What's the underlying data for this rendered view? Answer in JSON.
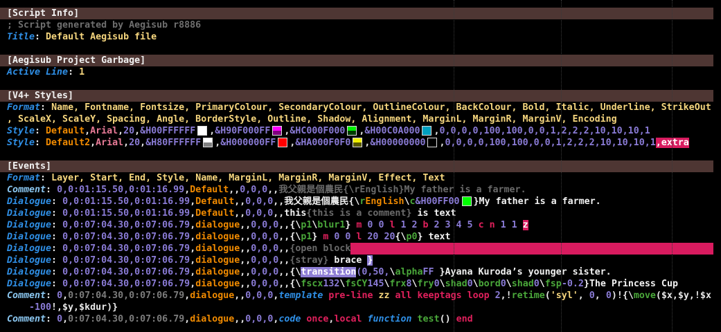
{
  "lines": [
    {
      "hdr": true,
      "segs": [
        [
          "t",
          "[Script Info]"
        ]
      ]
    },
    {
      "segs": [
        [
          "cm",
          "; Script generated by Aegisub r8886"
        ]
      ]
    },
    {
      "segs": [
        [
          "k",
          "Title"
        ],
        [
          "p",
          ": "
        ],
        [
          "v",
          "Default Aegisub file"
        ]
      ]
    },
    {
      "segs": []
    },
    {
      "hdr": true,
      "segs": [
        [
          "t",
          "[Aegisub Project Garbage]"
        ]
      ]
    },
    {
      "segs": [
        [
          "k",
          "Active Line"
        ],
        [
          "p",
          ": "
        ],
        [
          "v",
          "1"
        ]
      ]
    },
    {
      "segs": []
    },
    {
      "hdr": true,
      "segs": [
        [
          "t",
          "[V4+ Styles]"
        ]
      ]
    },
    {
      "segs": [
        [
          "k",
          "Format"
        ],
        [
          "p",
          ": "
        ],
        [
          "v",
          "Name, Fontname, Fontsize, PrimaryColour, SecondaryColour, OutlineColour, BackColour, Bold, Italic, Underline, StrikeOut"
        ]
      ]
    },
    {
      "segs": [
        [
          "v",
          ", ScaleX, ScaleY, Spacing, Angle, BorderStyle, Outline, Shadow, Alignment, MarginL, MarginR, MarginV, Encoding"
        ]
      ]
    },
    {
      "segs": [
        [
          "k",
          "Style"
        ],
        [
          "p",
          ": "
        ],
        [
          "s",
          "Default"
        ],
        [
          "p",
          ","
        ],
        [
          "f",
          "Arial"
        ],
        [
          "p",
          ","
        ],
        [
          "n",
          "20"
        ],
        [
          "p",
          ","
        ],
        [
          "n",
          "&H00FFFFFF"
        ],
        [
          "sw",
          "#ffffff",
          "#ffffff"
        ],
        [
          "p",
          ","
        ],
        [
          "n",
          "&H90F000FF"
        ],
        [
          "sw",
          "#ff00ff",
          "#800080"
        ],
        [
          "p",
          ","
        ],
        [
          "n",
          "&HC000F000"
        ],
        [
          "sw",
          "#00f000",
          "#003c00"
        ],
        [
          "p",
          ","
        ],
        [
          "n",
          "&H00C0A000"
        ],
        [
          "sw",
          "#00a0c0",
          "#00a0c0"
        ],
        [
          "p",
          ","
        ],
        [
          "n",
          "0,0,0,0,100,100,0,0,1,2,2,2,10,10,10,1"
        ]
      ]
    },
    {
      "segs": [
        [
          "k",
          "Style"
        ],
        [
          "p",
          ": "
        ],
        [
          "s",
          "Default2"
        ],
        [
          "p",
          ","
        ],
        [
          "f",
          "Arial"
        ],
        [
          "p",
          ","
        ],
        [
          "n",
          "20"
        ],
        [
          "p",
          ","
        ],
        [
          "n",
          "&H80FFFFFF"
        ],
        [
          "sw",
          "#ffffff",
          "#808080"
        ],
        [
          "p",
          ","
        ],
        [
          "n",
          "&H000000FF"
        ],
        [
          "sw",
          "#ff0000",
          "#ff0000"
        ],
        [
          "p",
          ","
        ],
        [
          "n",
          "&HA000F0F0"
        ],
        [
          "sw",
          "#f0f000",
          "#5a5a00"
        ],
        [
          "p",
          ","
        ],
        [
          "n",
          "&H00000000"
        ],
        [
          "sw",
          "#000000",
          "#000000"
        ],
        [
          "p",
          ","
        ],
        [
          "n",
          "0,0,0,0,100,100,0,0,1,2,2,2,10,10,10,1"
        ],
        [
          "err",
          ",extra"
        ]
      ]
    },
    {
      "segs": []
    },
    {
      "hdr": true,
      "segs": [
        [
          "t",
          "[Events]"
        ]
      ]
    },
    {
      "segs": [
        [
          "k",
          "Format"
        ],
        [
          "p",
          ": "
        ],
        [
          "v",
          "Layer, Start, End, Style, Name, MarginL, MarginR, MarginV, Effect, Text"
        ]
      ]
    },
    {
      "segs": [
        [
          "kc",
          "Comment"
        ],
        [
          "p",
          ": "
        ],
        [
          "n",
          "0,0:01:15.50,0:01:16.99"
        ],
        [
          "p",
          ","
        ],
        [
          "s",
          "Default"
        ],
        [
          "p",
          ",,"
        ],
        [
          "n",
          "0,0,0"
        ],
        [
          "p",
          ",,"
        ],
        [
          "x",
          "我父親是個農民{\\rEnglish}My father is a farmer."
        ]
      ]
    },
    {
      "segs": [
        [
          "k",
          "Dialogue"
        ],
        [
          "p",
          ": "
        ],
        [
          "n",
          "0,0:01:15.50,0:01:16.99"
        ],
        [
          "p",
          ","
        ],
        [
          "s",
          "Default"
        ],
        [
          "p",
          ",,"
        ],
        [
          "n",
          "0,0,0"
        ],
        [
          "p",
          ",,"
        ],
        [
          "t",
          "我父親是個農民{\\"
        ],
        [
          "tg",
          "r"
        ],
        [
          "s",
          "English"
        ],
        [
          "t",
          "\\"
        ],
        [
          "tg",
          "c"
        ],
        [
          "n",
          "&H00FF00"
        ],
        [
          "sw",
          "#00ff00",
          "#00ff00"
        ],
        [
          "t",
          "}My father is a farmer."
        ]
      ]
    },
    {
      "segs": [
        [
          "k",
          "Dialogue"
        ],
        [
          "p",
          ": "
        ],
        [
          "n",
          "0,0:01:15.50,0:01:16.99"
        ],
        [
          "p",
          ","
        ],
        [
          "s",
          "Default"
        ],
        [
          "p",
          ",,"
        ],
        [
          "n",
          "0,0,0"
        ],
        [
          "p",
          ",,"
        ],
        [
          "t",
          "this"
        ],
        [
          "x",
          "{this is a comment}"
        ],
        [
          "t",
          " is text"
        ]
      ]
    },
    {
      "segs": [
        [
          "k",
          "Dialogue"
        ],
        [
          "p",
          ": "
        ],
        [
          "n",
          "0,0:07:04.30,0:07:06.79"
        ],
        [
          "p",
          ","
        ],
        [
          "s",
          "dialogue"
        ],
        [
          "p",
          ",,"
        ],
        [
          "n",
          "0,0,0"
        ],
        [
          "p",
          ",,"
        ],
        [
          "t",
          "{\\"
        ],
        [
          "tg",
          "p1"
        ],
        [
          "t",
          "\\"
        ],
        [
          "tg",
          "blur1"
        ],
        [
          "t",
          "} "
        ],
        [
          "d",
          "m"
        ],
        [
          "n",
          " 0 0 "
        ],
        [
          "d",
          "l"
        ],
        [
          "n",
          " 1 2 "
        ],
        [
          "d",
          "b"
        ],
        [
          "n",
          " 2 3 4 5 "
        ],
        [
          "d",
          "c n"
        ],
        [
          "n",
          " 1 1 "
        ],
        [
          "err",
          "z"
        ]
      ]
    },
    {
      "segs": [
        [
          "k",
          "Dialogue"
        ],
        [
          "p",
          ": "
        ],
        [
          "n",
          "0,0:07:04.30,0:07:06.79"
        ],
        [
          "p",
          ","
        ],
        [
          "s",
          "dialogue"
        ],
        [
          "p",
          ",,"
        ],
        [
          "n",
          "0,0,0"
        ],
        [
          "p",
          ",,"
        ],
        [
          "t",
          "{\\"
        ],
        [
          "tg",
          "p1"
        ],
        [
          "t",
          "} "
        ],
        [
          "d",
          "m"
        ],
        [
          "n",
          " 0 0 "
        ],
        [
          "d",
          "l"
        ],
        [
          "n",
          " 20 20"
        ],
        [
          "t",
          "{\\"
        ],
        [
          "tg",
          "p0"
        ],
        [
          "t",
          "} text"
        ]
      ]
    },
    {
      "segs": [
        [
          "k",
          "Dialogue"
        ],
        [
          "p",
          ": "
        ],
        [
          "n",
          "0,0:07:04.30,0:07:06.79"
        ],
        [
          "p",
          ","
        ],
        [
          "s",
          "dialogue"
        ],
        [
          "p",
          ",,"
        ],
        [
          "n",
          "0,0,0"
        ],
        [
          "p",
          ",,"
        ],
        [
          "x",
          "{open block"
        ],
        [
          "fill",
          ""
        ]
      ]
    },
    {
      "segs": [
        [
          "k",
          "Dialogue"
        ],
        [
          "p",
          ": "
        ],
        [
          "n",
          "0,0:07:04.30,0:07:06.79"
        ],
        [
          "p",
          ","
        ],
        [
          "s",
          "dialogue"
        ],
        [
          "p",
          ",,"
        ],
        [
          "n",
          "0,0,0"
        ],
        [
          "p",
          ",,"
        ],
        [
          "x",
          "{stray}"
        ],
        [
          "t",
          " brace "
        ],
        [
          "hl",
          "}"
        ]
      ]
    },
    {
      "segs": [
        [
          "k",
          "Dialogue"
        ],
        [
          "p",
          ": "
        ],
        [
          "n",
          "0,0:07:04.30,0:07:06.79"
        ],
        [
          "p",
          ","
        ],
        [
          "s",
          "dialogue"
        ],
        [
          "p",
          ",,"
        ],
        [
          "n",
          "0,0,0"
        ],
        [
          "p",
          ",,"
        ],
        [
          "t",
          "{\\"
        ],
        [
          "hl",
          "transition"
        ],
        [
          "n",
          "(0,50,"
        ],
        [
          "t",
          "\\"
        ],
        [
          "tg",
          "alpha"
        ],
        [
          "n",
          "FF"
        ],
        [
          "t",
          " }Ayana Kuroda’s younger sister."
        ]
      ]
    },
    {
      "segs": [
        [
          "k",
          "Dialogue"
        ],
        [
          "p",
          ": "
        ],
        [
          "n",
          "0,0:07:04.30,0:07:06.79"
        ],
        [
          "p",
          ","
        ],
        [
          "s",
          "dialogue"
        ],
        [
          "p",
          ",,"
        ],
        [
          "n",
          "0,0,0"
        ],
        [
          "p",
          ",,"
        ],
        [
          "t",
          "{\\"
        ],
        [
          "tg",
          "fscx"
        ],
        [
          "n",
          "132"
        ],
        [
          "t",
          "\\"
        ],
        [
          "tg",
          "fsCY"
        ],
        [
          "n",
          "145"
        ],
        [
          "t",
          "\\"
        ],
        [
          "tg",
          "frx"
        ],
        [
          "n",
          "8"
        ],
        [
          "t",
          "\\"
        ],
        [
          "tg",
          "fry"
        ],
        [
          "n",
          "0"
        ],
        [
          "t",
          "\\"
        ],
        [
          "tg",
          "shad"
        ],
        [
          "n",
          "0"
        ],
        [
          "t",
          "\\"
        ],
        [
          "tg",
          "bord"
        ],
        [
          "n",
          "0"
        ],
        [
          "t",
          "\\"
        ],
        [
          "tg",
          "shad"
        ],
        [
          "n",
          "0"
        ],
        [
          "t",
          "\\"
        ],
        [
          "tg",
          "fsp"
        ],
        [
          "n",
          "-0.2"
        ],
        [
          "t",
          "}The Princess Cup"
        ]
      ]
    },
    {
      "segs": [
        [
          "kc",
          "Comment"
        ],
        [
          "p",
          ": "
        ],
        [
          "n",
          "0"
        ],
        [
          "p",
          ","
        ],
        [
          "tm",
          "0:07:04.30,0:07:06.79"
        ],
        [
          "p",
          ","
        ],
        [
          "s",
          "dialogue"
        ],
        [
          "p",
          ",,"
        ],
        [
          "n",
          "0,0,0"
        ],
        [
          "p",
          ","
        ],
        [
          "kw",
          "template"
        ],
        [
          "p",
          " "
        ],
        [
          "d",
          "pre-line"
        ],
        [
          "p",
          " "
        ],
        [
          "v",
          "zz"
        ],
        [
          "p",
          " "
        ],
        [
          "d",
          "all"
        ],
        [
          "p",
          " "
        ],
        [
          "d",
          "keeptags"
        ],
        [
          "p",
          " "
        ],
        [
          "d",
          "loop"
        ],
        [
          "n",
          " 2"
        ],
        [
          "p",
          ",!"
        ],
        [
          "tg",
          "retime"
        ],
        [
          "p",
          "("
        ],
        [
          "v",
          "'syl'"
        ],
        [
          "p",
          ", "
        ],
        [
          "n",
          "0"
        ],
        [
          "p",
          ", "
        ],
        [
          "n",
          "0"
        ],
        [
          "p",
          ")!{\\"
        ],
        [
          "tg",
          "move"
        ],
        [
          "p",
          "($x,$y,!$x"
        ]
      ]
    },
    {
      "wrap": true,
      "segs": [
        [
          "n",
          "-100"
        ],
        [
          "p",
          "!,$y,$kdur)}"
        ]
      ]
    },
    {
      "segs": [
        [
          "kc",
          "Comment"
        ],
        [
          "p",
          ": "
        ],
        [
          "n",
          "0"
        ],
        [
          "p",
          ","
        ],
        [
          "tm",
          "0:07:04.30,0:07:06.79"
        ],
        [
          "p",
          ","
        ],
        [
          "s",
          "dialogue"
        ],
        [
          "p",
          ",,"
        ],
        [
          "n",
          "0,0,0"
        ],
        [
          "p",
          ","
        ],
        [
          "kw",
          "code"
        ],
        [
          "p",
          " "
        ],
        [
          "d",
          "once"
        ],
        [
          "p",
          ","
        ],
        [
          "d",
          "local"
        ],
        [
          "p",
          " "
        ],
        [
          "kw",
          "function"
        ],
        [
          "p",
          " "
        ],
        [
          "tg",
          "test"
        ],
        [
          "p",
          "() "
        ],
        [
          "d",
          "end"
        ]
      ]
    }
  ]
}
